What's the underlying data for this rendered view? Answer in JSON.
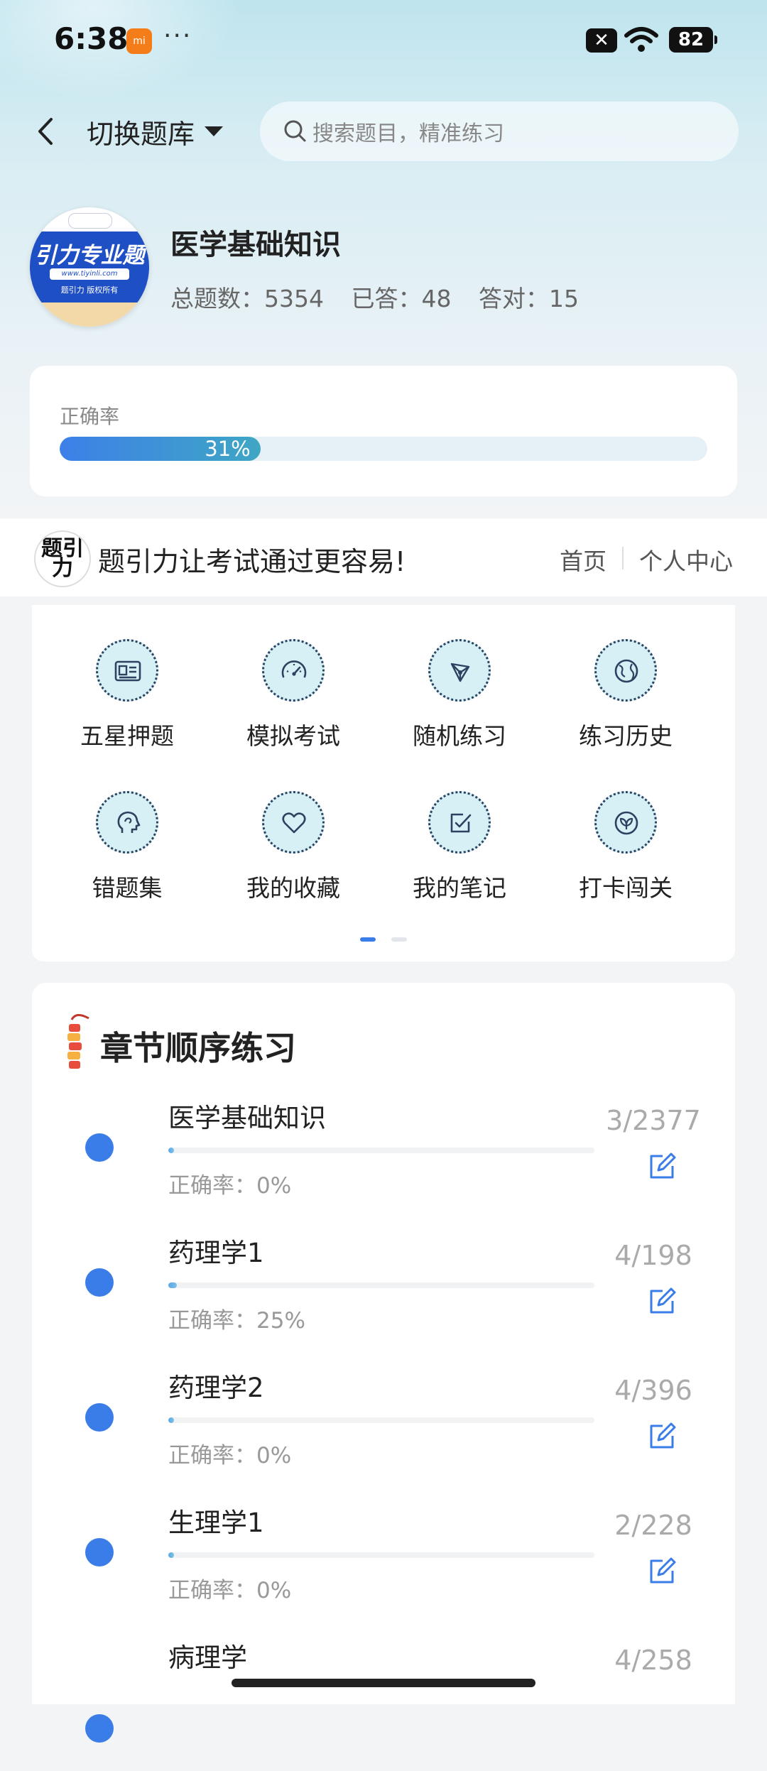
{
  "status_bar": {
    "time": "6:38",
    "more": "···",
    "close_badge": "✕",
    "battery": "82"
  },
  "header": {
    "bank_title": "切换题库",
    "search_placeholder": "搜索题目，精准练习"
  },
  "subject": {
    "logo_big": "引力专业题",
    "logo_url": "www.tiyinli.com",
    "logo_copy": "题引力 版权所有",
    "name": "医学基础知识",
    "total_label": "总题数：5354",
    "answered_label": "已答：48",
    "correct_label": "答对：15"
  },
  "accuracy": {
    "label": "正确率",
    "value_text": "31%",
    "value": 0.31
  },
  "promo": {
    "logo_text": "题引力",
    "slogan": "题引力让考试通过更容易!",
    "home": "首页",
    "me": "个人中心"
  },
  "grid": {
    "items": [
      {
        "label": "五星押题",
        "icon": "id-card-icon"
      },
      {
        "label": "模拟考试",
        "icon": "speedometer-icon"
      },
      {
        "label": "随机练习",
        "icon": "network-icon"
      },
      {
        "label": "练习历史",
        "icon": "globe-icon"
      },
      {
        "label": "错题集",
        "icon": "head-icon"
      },
      {
        "label": "我的收藏",
        "icon": "heart-icon"
      },
      {
        "label": "我的笔记",
        "icon": "note-check-icon"
      },
      {
        "label": "打卡闯关",
        "icon": "leaf-icon"
      }
    ],
    "page_index": 1,
    "page_count": 2
  },
  "chapters": {
    "title": "章节顺序练习",
    "rows": [
      {
        "name": "医学基础知识",
        "accuracy": "正确率：0%",
        "count": "3/2377",
        "progress": 0.001
      },
      {
        "name": "药理学1",
        "accuracy": "正确率：25%",
        "count": "4/198",
        "progress": 0.02
      },
      {
        "name": "药理学2",
        "accuracy": "正确率：0%",
        "count": "4/396",
        "progress": 0.01
      },
      {
        "name": "生理学1",
        "accuracy": "正确率：0%",
        "count": "2/228",
        "progress": 0.009
      },
      {
        "name": "病理学",
        "accuracy": "",
        "count": "4/258",
        "progress": 0.015
      }
    ]
  },
  "colors": {
    "accent": "#3b7de8",
    "teal": "#3fa6c4",
    "icon_bg": "#d6f0f6",
    "icon_stroke": "#2b4360"
  }
}
